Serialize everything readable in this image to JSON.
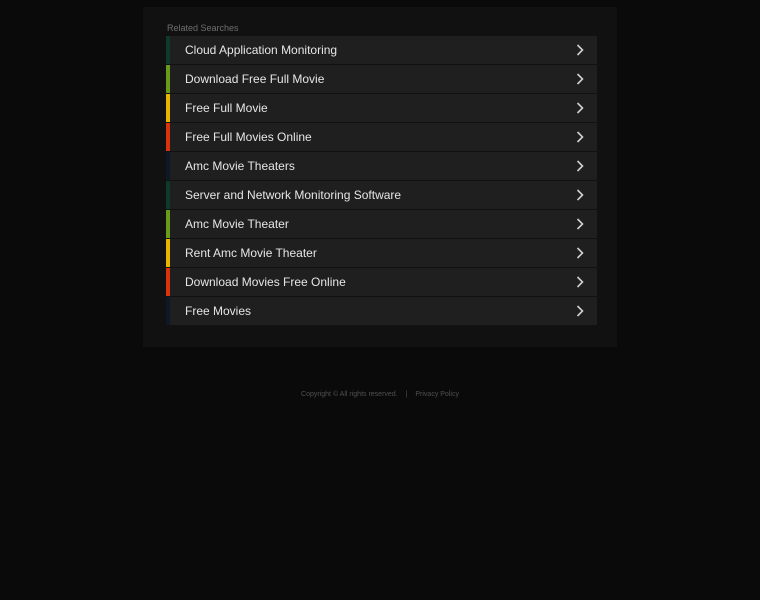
{
  "related": {
    "heading": "Related Searches",
    "items": [
      {
        "label": "Cloud Application Monitoring",
        "color": "#0f3a2a"
      },
      {
        "label": "Download Free Full Movie",
        "color": "#6a9a1a"
      },
      {
        "label": "Free Full Movie",
        "color": "#e8b400"
      },
      {
        "label": "Free Full Movies Online",
        "color": "#d8330a"
      },
      {
        "label": "Amc Movie Theaters",
        "color": "#0e1826"
      },
      {
        "label": "Server and Network Monitoring Software",
        "color": "#0f3a2a"
      },
      {
        "label": "Amc Movie Theater",
        "color": "#6a9a1a"
      },
      {
        "label": "Rent Amc Movie Theater",
        "color": "#e8b400"
      },
      {
        "label": "Download Movies Free Online",
        "color": "#d8330a"
      },
      {
        "label": "Free Movies",
        "color": "#0e1826"
      }
    ],
    "chevron_icon": "chevron-right-icon"
  },
  "footer": {
    "copyright": "Copyright ©  All rights reserved.",
    "separator": "|",
    "privacy": "Privacy Policy"
  }
}
